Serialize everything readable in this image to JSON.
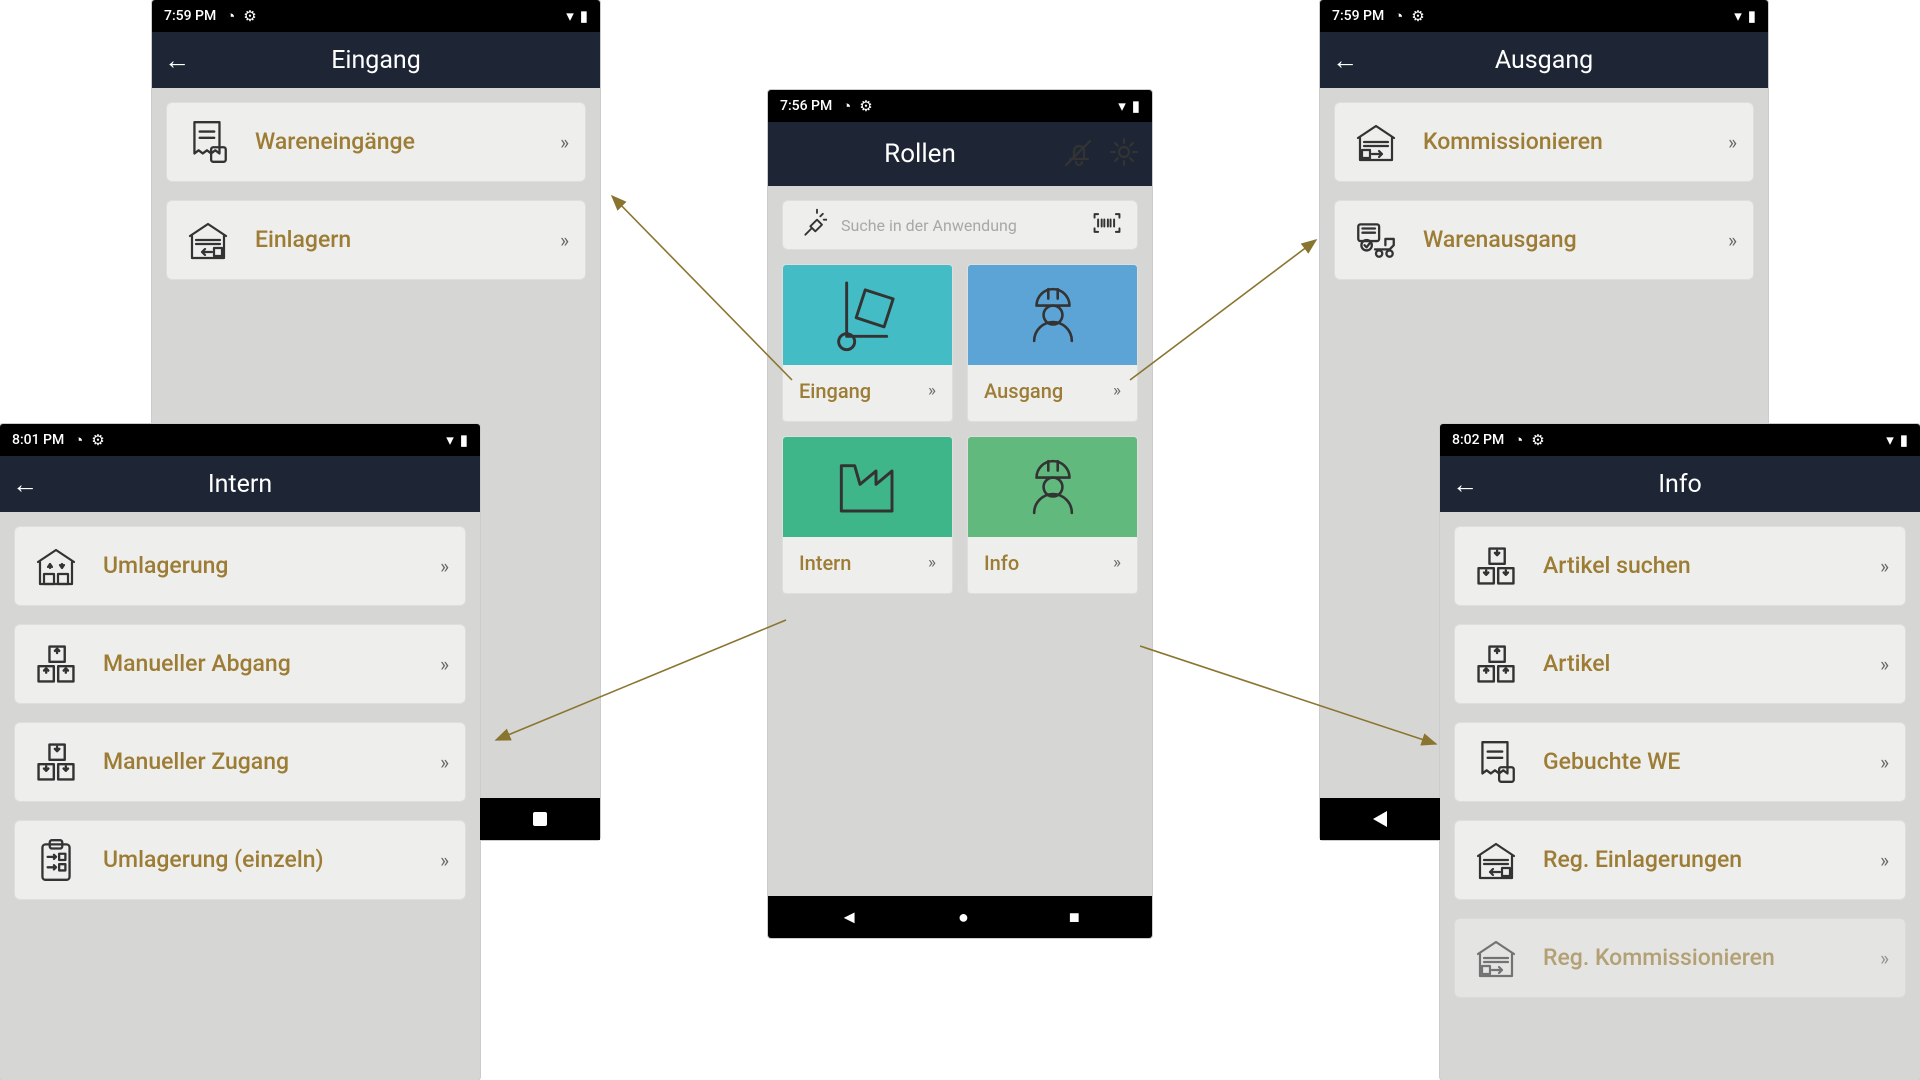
{
  "center": {
    "status_time": "7:56 PM",
    "appbar_title": "Rollen",
    "search_placeholder": "Suche in der Anwendung",
    "tiles": [
      {
        "label": "Eingang",
        "color": "#44bcc6"
      },
      {
        "label": "Ausgang",
        "color": "#5da4d6"
      },
      {
        "label": "Intern",
        "color": "#3fb58a"
      },
      {
        "label": "Info",
        "color": "#61b97e"
      }
    ]
  },
  "eingang": {
    "status_time": "7:59 PM",
    "title": "Eingang",
    "items": [
      {
        "label": "Wareneingänge",
        "icon": "receipt"
      },
      {
        "label": "Einlagern",
        "icon": "garage-in"
      }
    ]
  },
  "ausgang": {
    "status_time": "7:59 PM",
    "title": "Ausgang",
    "items": [
      {
        "label": "Kommissionieren",
        "icon": "garage-out"
      },
      {
        "label": "Warenausgang",
        "icon": "truck-check"
      }
    ]
  },
  "intern": {
    "status_time": "8:01 PM",
    "title": "Intern",
    "items": [
      {
        "label": "Umlagerung",
        "icon": "garage-ud"
      },
      {
        "label": "Manueller Abgang",
        "icon": "boxes-up"
      },
      {
        "label": "Manueller Zugang",
        "icon": "boxes-down"
      },
      {
        "label": "Umlagerung (einzeln)",
        "icon": "clipboard-arrows"
      }
    ]
  },
  "info": {
    "status_time": "8:02 PM",
    "title": "Info",
    "items": [
      {
        "label": "Artikel suchen",
        "icon": "boxes-down"
      },
      {
        "label": "Artikel",
        "icon": "boxes-up"
      },
      {
        "label": "Gebuchte WE",
        "icon": "receipt"
      },
      {
        "label": "Reg. Einlagerungen",
        "icon": "garage-in"
      },
      {
        "label": "Reg. Kommissionieren",
        "icon": "garage-out"
      }
    ]
  }
}
